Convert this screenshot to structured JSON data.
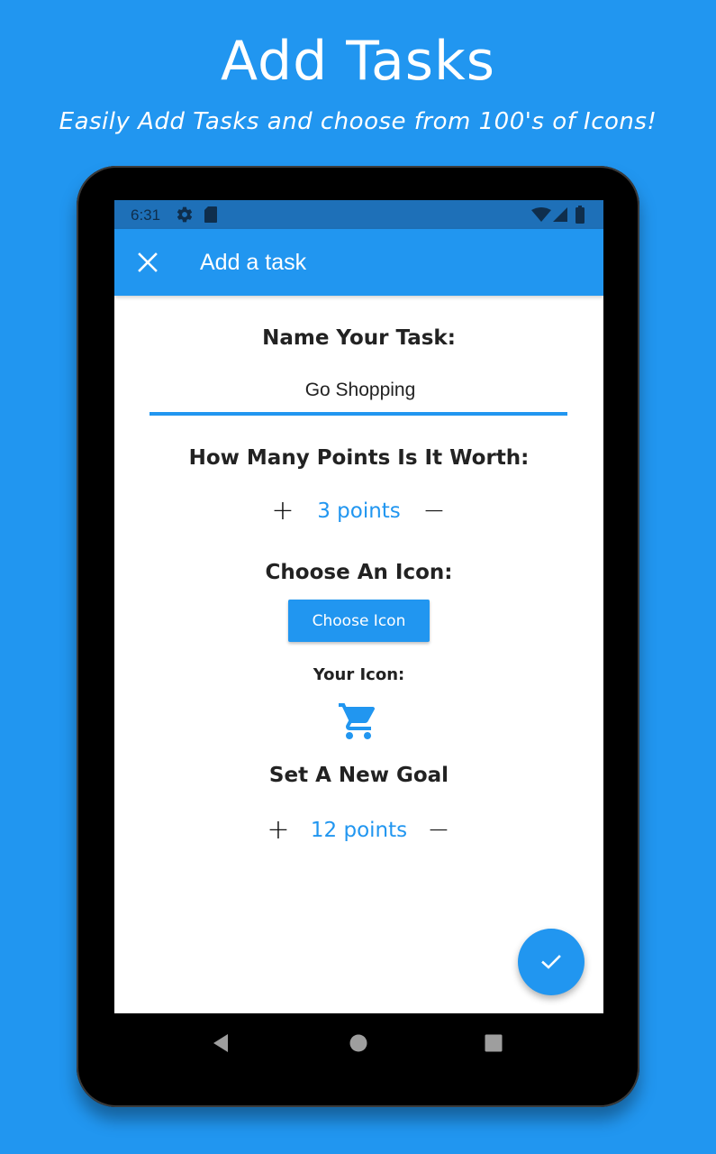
{
  "promo": {
    "title": "Add Tasks",
    "subtitle": "Easily Add Tasks and choose from 100's of Icons!"
  },
  "status_bar": {
    "time": "6:31",
    "left_icons": [
      "gear-icon",
      "sd-card-icon"
    ],
    "right_icons": [
      "wifi-icon",
      "cell-signal-icon",
      "battery-icon"
    ]
  },
  "app_bar": {
    "close_icon": "close-icon",
    "title": "Add a task"
  },
  "form": {
    "name_heading": "Name Your Task:",
    "task_name_value": "Go Shopping",
    "points_heading": "How Many Points Is It Worth:",
    "points": {
      "plus_label": "+",
      "value_label": "3 points",
      "value": 3,
      "minus_label": "−"
    },
    "icon_heading": "Choose An Icon:",
    "choose_icon_button": "Choose Icon",
    "your_icon_label": "Your Icon:",
    "selected_icon": "shopping-cart-icon",
    "goal_heading": "Set A New Goal",
    "goal": {
      "plus_label": "+",
      "value_label": "12 points",
      "value": 12,
      "minus_label": "−"
    }
  },
  "fab": {
    "icon": "check-icon"
  },
  "nav_bar": {
    "icons": [
      "back-icon",
      "home-icon",
      "recents-icon"
    ]
  },
  "colors": {
    "background": "#2196F0",
    "primary": "#2196F0",
    "status_bar": "#1E70B8",
    "text_dark": "#222222",
    "nav_icon": "#9e9e9e"
  }
}
